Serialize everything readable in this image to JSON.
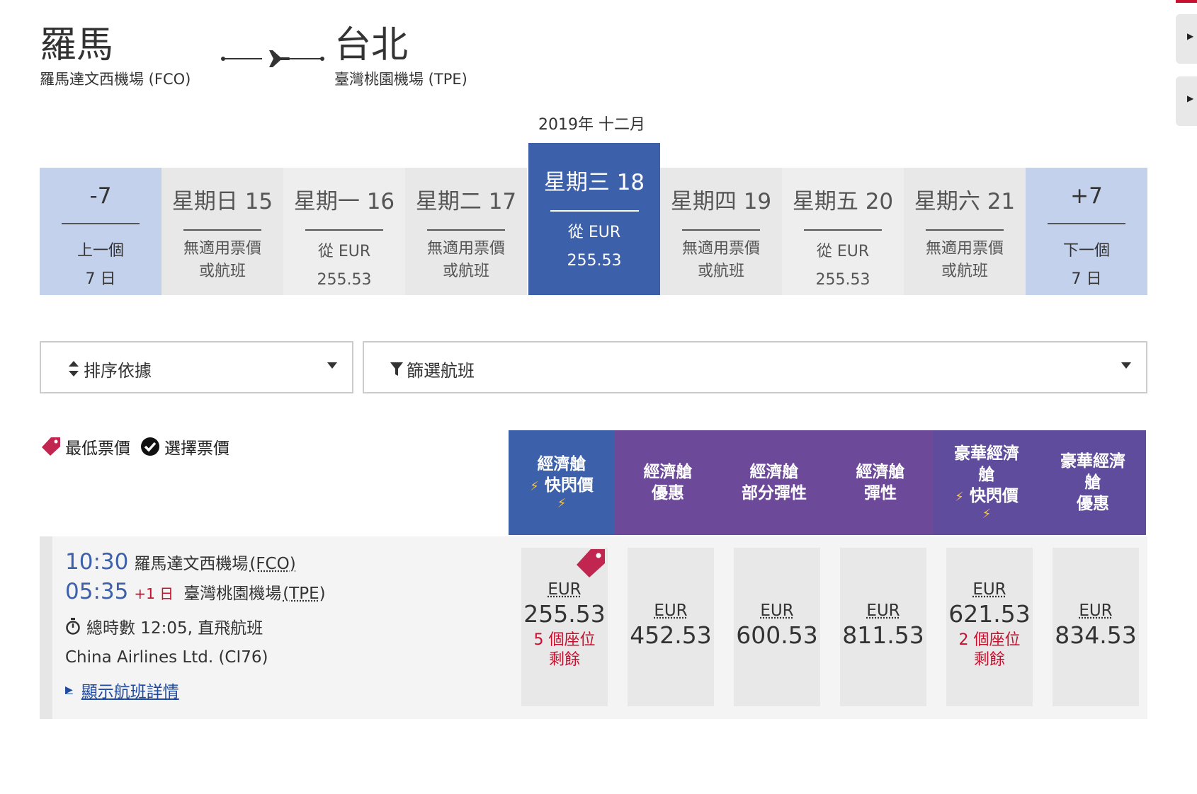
{
  "route": {
    "origin_city": "羅馬",
    "origin_airport": "羅馬達文西機場 (FCO)",
    "dest_city": "台北",
    "dest_airport": "臺灣桃園機場 (TPE)"
  },
  "month_label": "2019年 十二月",
  "dates": [
    {
      "day": "-7",
      "line1": "上一個",
      "line2": "7 日"
    },
    {
      "day": "星期日 15",
      "line1": "無適用票價",
      "line2": "或航班"
    },
    {
      "day": "星期一 16",
      "line1": "從 EUR",
      "line2": "255.53"
    },
    {
      "day": "星期二 17",
      "line1": "無適用票價",
      "line2": "或航班"
    },
    {
      "day": "星期三 18",
      "line1": "從 EUR",
      "line2": "255.53"
    },
    {
      "day": "星期四 19",
      "line1": "無適用票價",
      "line2": "或航班"
    },
    {
      "day": "星期五 20",
      "line1": "從 EUR",
      "line2": "255.53"
    },
    {
      "day": "星期六 21",
      "line1": "無適用票價",
      "line2": "或航班"
    },
    {
      "day": "+7",
      "line1": "下一個",
      "line2": "7 日"
    }
  ],
  "controls": {
    "sort_label": "排序依據",
    "filter_label": "篩選航班"
  },
  "legend": {
    "lowest": "最低票價",
    "selected": "選擇票價"
  },
  "fare_headers": [
    {
      "line1": "經濟艙",
      "line2": "快閃價",
      "flash": true,
      "color": "#3c60a9"
    },
    {
      "line1": "經濟艙",
      "line2": "優惠",
      "flash": false,
      "color": "#6c4a99"
    },
    {
      "line1": "經濟艙",
      "line2": "部分彈性",
      "flash": false,
      "color": "#6c4a99"
    },
    {
      "line1": "經濟艙",
      "line2": "彈性",
      "flash": false,
      "color": "#6c4a99"
    },
    {
      "line1": "豪華經濟艙",
      "line2": "快閃價",
      "flash": true,
      "color": "#5f4c9c"
    },
    {
      "line1": "豪華經濟艙",
      "line2": "優惠",
      "flash": false,
      "color": "#5f4c9c"
    }
  ],
  "flight": {
    "dep_time": "10:30",
    "dep_airport": "羅馬達文西機場",
    "dep_code": "(FCO)",
    "arr_time": "05:35",
    "arr_plus": "+1 日",
    "arr_airport": "臺灣桃園機場",
    "arr_code": "(TPE)",
    "duration": "總時數 12:05, 直飛航班",
    "airline": "China Airlines Ltd. (CI76)",
    "details_link": "顯示航班詳情"
  },
  "fares": [
    {
      "currency": "EUR",
      "amount": "255.53",
      "seats_line1": "5 個座位",
      "seats_line2": "剩餘",
      "lowest": true
    },
    {
      "currency": "EUR",
      "amount": "452.53",
      "seats_line1": "",
      "seats_line2": "",
      "lowest": false
    },
    {
      "currency": "EUR",
      "amount": "600.53",
      "seats_line1": "",
      "seats_line2": "",
      "lowest": false
    },
    {
      "currency": "EUR",
      "amount": "811.53",
      "seats_line1": "",
      "seats_line2": "",
      "lowest": false
    },
    {
      "currency": "EUR",
      "amount": "621.53",
      "seats_line1": "2 個座位",
      "seats_line2": "剩餘",
      "lowest": false
    },
    {
      "currency": "EUR",
      "amount": "834.53",
      "seats_line1": "",
      "seats_line2": "",
      "lowest": false
    }
  ],
  "colors": {
    "selected_date": "#3c60a9",
    "nav_date": "#c3d1ed",
    "brand_red": "#c8102e",
    "link_blue": "#1f4aa0"
  }
}
